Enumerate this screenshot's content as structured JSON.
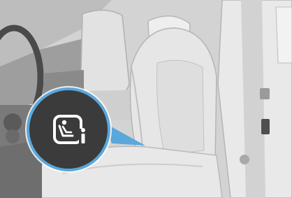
{
  "illustration": {
    "subject": "car-front-seat-interior",
    "callout_icon": "child-seat-isofix-info-icon",
    "colors": {
      "callout_ring": "#5aa7dc",
      "callout_fill": "#3b3b3b",
      "icon_stroke": "#ffffff",
      "seat_light": "#e6e6e6",
      "seat_shadow": "#b9b9b9",
      "cabin_dark": "#585858"
    }
  }
}
